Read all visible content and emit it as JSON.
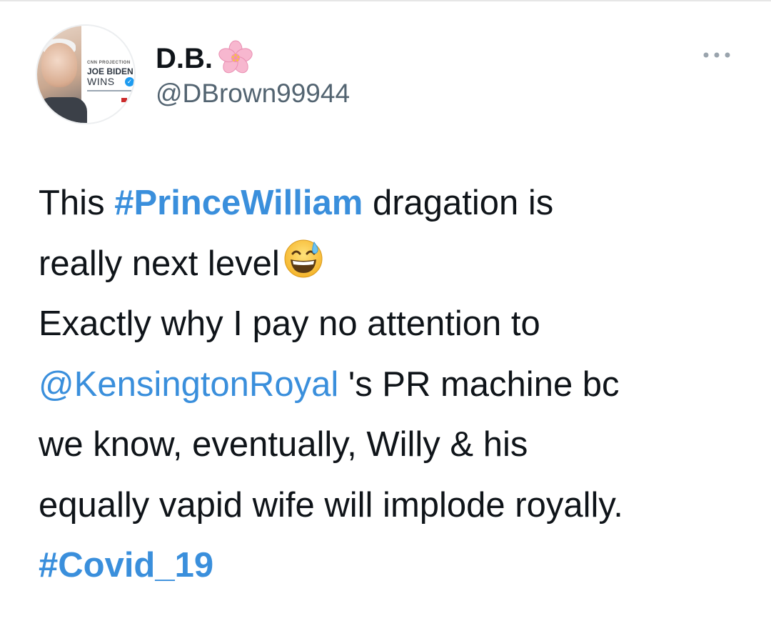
{
  "author": {
    "display_name": "D.B.",
    "name_emoji": "cherry-blossom-icon",
    "username": "@DBrown99944",
    "avatar": {
      "kicker": "CNN PROJECTION",
      "headline_line1": "JOE BIDEN",
      "headline_line2": "WINS"
    }
  },
  "actions": {
    "more_icon": "more-horizontal-icon"
  },
  "tweet": {
    "line1": {
      "before": "This ",
      "hashtag": "#PrinceWilliam",
      "after": " dragation is"
    },
    "line2": {
      "text": "really next level",
      "emoji": "grinning-face-with-sweat-icon"
    },
    "line3": "Exactly why I pay no attention to",
    "line4": {
      "mention": "@KensingtonRoyal",
      "after": " 's PR machine bc"
    },
    "line5": "we know, eventually, Willy & his",
    "line6": "equally vapid wife will implode royally.",
    "line7": {
      "hashtag": "#Covid_19"
    }
  },
  "colors": {
    "link": "#3a8fdc",
    "text": "#0f1419",
    "secondary": "#536471"
  }
}
